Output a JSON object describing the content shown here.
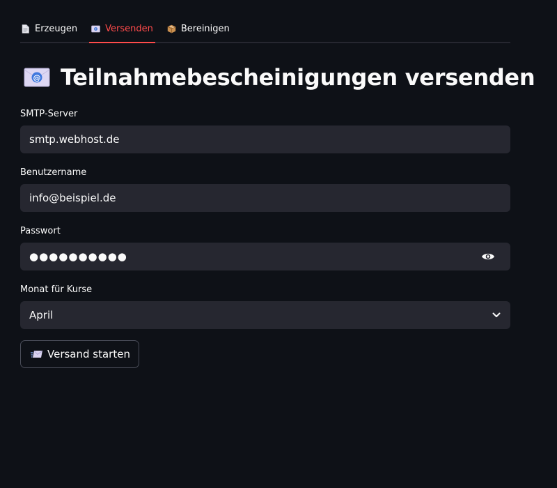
{
  "tabs": [
    {
      "label": "Erzeugen",
      "icon": "document-icon",
      "active": false
    },
    {
      "label": "Versenden",
      "icon": "email-icon",
      "active": true
    },
    {
      "label": "Bereinigen",
      "icon": "package-icon",
      "active": false
    }
  ],
  "header": {
    "title": "Teilnahmebescheinigungen versenden",
    "icon": "email-icon"
  },
  "form": {
    "smtp": {
      "label": "SMTP-Server",
      "value": "smtp.webhost.de"
    },
    "username": {
      "label": "Benutzername",
      "value": "info@beispiel.de"
    },
    "password": {
      "label": "Passwort",
      "value": "●●●●●●●●●●",
      "visibility_icon": "eye-icon"
    },
    "month": {
      "label": "Monat für Kurse",
      "value": "April",
      "dropdown_icon": "chevron-down-icon"
    }
  },
  "actions": {
    "send_label": "Versand starten",
    "send_icon": "send-mail-icon"
  },
  "colors": {
    "background": "#0e1117",
    "field_bg": "#262730",
    "accent": "#ff4b4b",
    "text": "#fafafa"
  }
}
